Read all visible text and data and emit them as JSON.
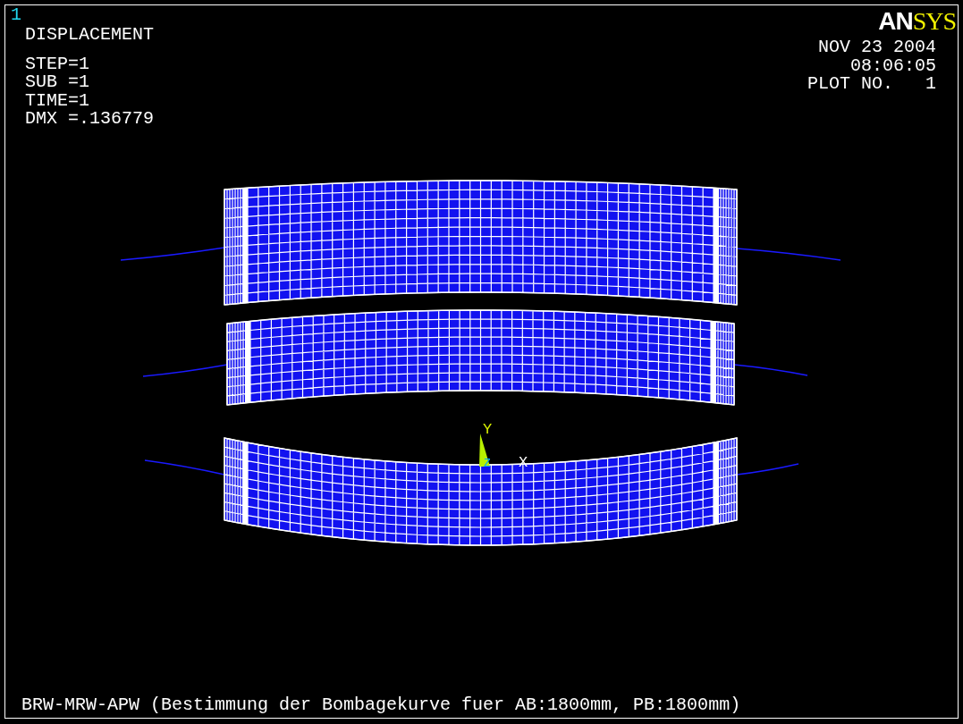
{
  "window": {
    "number": "1",
    "logo": [
      {
        "text": "AN",
        "kind": "sans"
      },
      {
        "text": "SYS",
        "kind": "serif"
      }
    ]
  },
  "plot_info": {
    "title": "DISPLACEMENT",
    "lines": [
      "STEP=1",
      "SUB =1",
      "TIME=1",
      "DMX =.136779"
    ]
  },
  "timestamp": {
    "date": "NOV 23 2004",
    "time": "08:06:05",
    "plot_number": "PLOT NO.   1"
  },
  "triad": {
    "labels": [
      {
        "text": "Y",
        "kind": "y"
      },
      {
        "text": "Z",
        "kind": "z"
      },
      {
        "text": "X",
        "kind": "x"
      }
    ]
  },
  "footer": "BRW-MRW-APW (Bestimmung der Bombagekurve fuer AB:1800mm, PB:1800mm)"
}
